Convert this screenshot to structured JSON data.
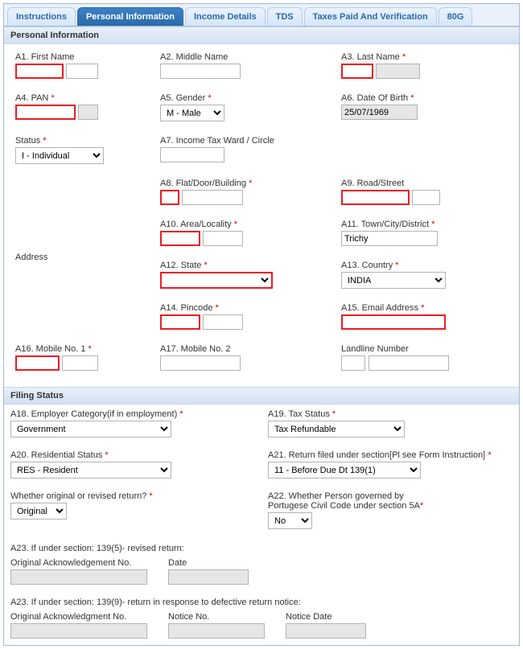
{
  "tabs": {
    "instructions": "Instructions",
    "personal": "Personal Information",
    "income": "Income Details",
    "tds": "TDS",
    "taxes": "Taxes Paid And Verification",
    "g80": "80G"
  },
  "section": {
    "personal": "Personal Information",
    "filing": "Filing Status"
  },
  "p": {
    "a1": "A1. First Name",
    "a2": "A2. Middle Name",
    "a3": "A3. Last Name",
    "a4": "A4. PAN",
    "a5": "A5. Gender",
    "a5_val": "M - Male",
    "a6": "A6. Date Of Birth",
    "a6_val": "25/07/1969",
    "status": "Status",
    "status_val": "I - Individual",
    "a7": "A7. Income Tax Ward / Circle",
    "address": "Address",
    "a8": "A8. Flat/Door/Building",
    "a9": "A9. Road/Street",
    "a10": "A10. Area/Locality",
    "a11": "A11. Town/City/District",
    "a11_val": "Trichy",
    "a12": "A12. State",
    "a12_val": "",
    "a13": "A13. Country",
    "a13_val": "INDIA",
    "a14": "A14. Pincode",
    "a15": "A15. Email Address",
    "a16": "A16. Mobile No. 1",
    "a17": "A17. Mobile No. 2",
    "landline": "Landline Number"
  },
  "f": {
    "a18": "A18. Employer Category(if in employment)",
    "a18_val": "Government",
    "a19": "A19. Tax Status",
    "a19_val": "Tax Refundable",
    "a20": "A20. Residential Status",
    "a20_val": "RES - Resident",
    "a21": "A21. Return filed under section[Pl see Form Instruction]",
    "a21_val": "11 - Before Due Dt 139(1)",
    "orig": "Whether original or revised return?",
    "orig_val": "Original",
    "a22_l1": "A22. Whether Person governed by",
    "a22_l2": "Portugese Civil Code under section 5A",
    "a22_val": "No",
    "a23_5": "A23. If under section: 139(5)- revised return:",
    "oack": "Original Acknowledgement No.",
    "date": "Date",
    "a23_9": "A23. If under section: 139(9)- return in response to defective return notice:",
    "oack2": "Original Acknowledgment No.",
    "nno": "Notice No.",
    "ndate": "Notice Date"
  },
  "star": "*"
}
